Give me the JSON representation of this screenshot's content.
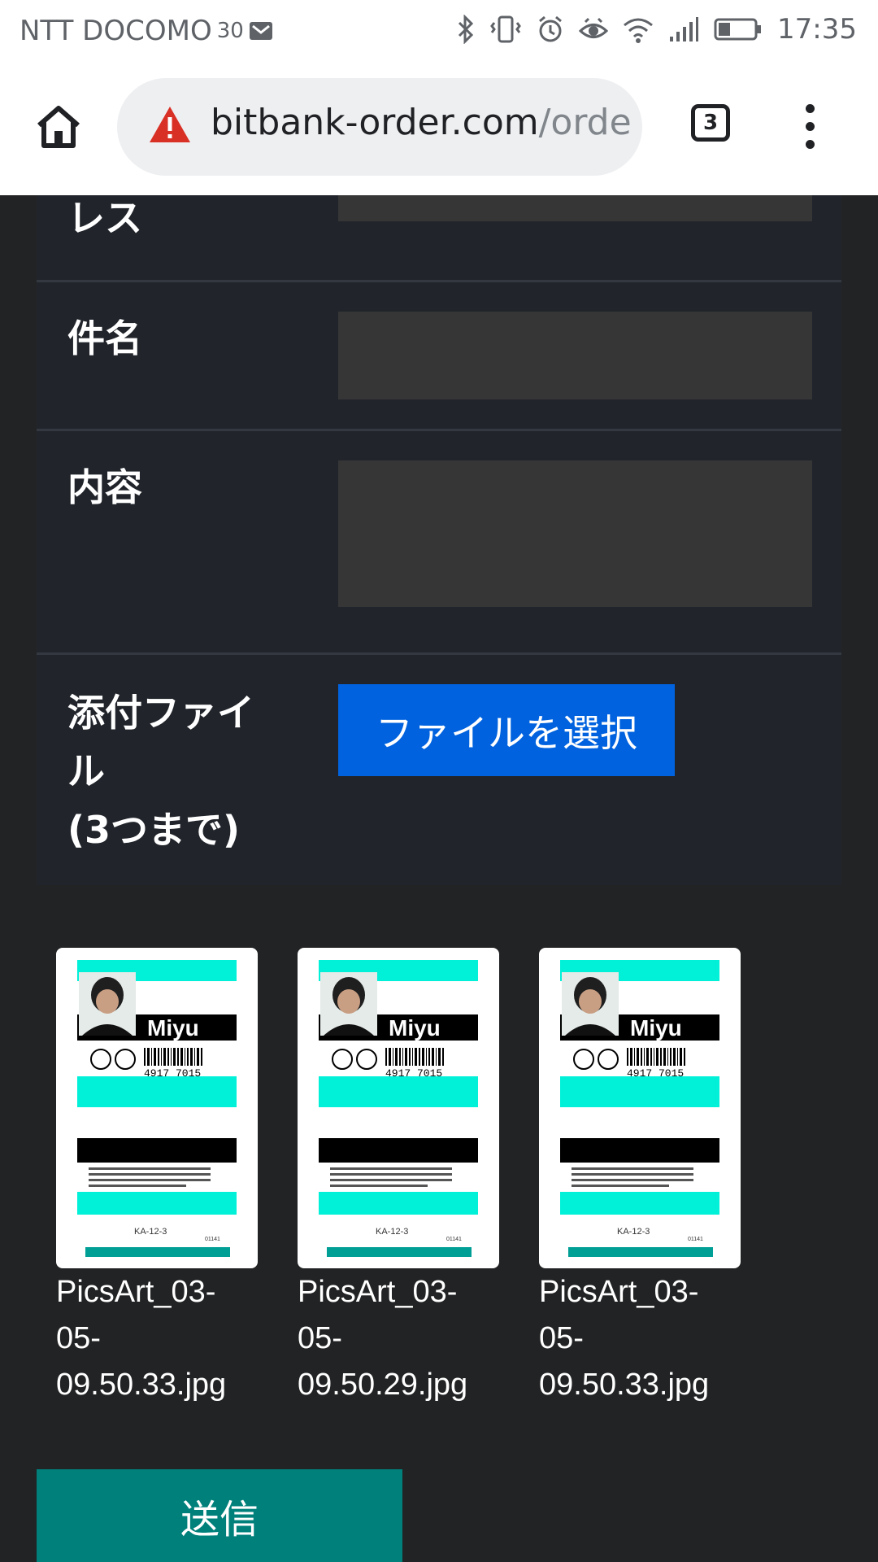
{
  "status_bar": {
    "carrier": "NTT DOCOMO",
    "carrier_extra": "30",
    "time": "17:35"
  },
  "browser": {
    "url_host": "bitbank-order.com",
    "url_path": "/orde",
    "tab_count": "3"
  },
  "form": {
    "fields": [
      {
        "label": "レス"
      },
      {
        "label": "件名"
      },
      {
        "label": "内容"
      },
      {
        "label_lines": [
          "添付ファイ",
          "ル",
          "(3つまで)"
        ]
      }
    ],
    "file_button_label": "ファイルを選択"
  },
  "attachments": [
    {
      "file_name_lines": [
        "PicsArt_03-",
        "05-",
        "09.50.33.jpg"
      ],
      "card_name": "Miyu",
      "barcode_number": "4917 7015",
      "code": "KA-12-3",
      "small_code": "01141"
    },
    {
      "file_name_lines": [
        "PicsArt_03-",
        "05-",
        "09.50.29.jpg"
      ],
      "card_name": "Miyu",
      "barcode_number": "4917 7015",
      "code": "KA-12-3",
      "small_code": "01141"
    },
    {
      "file_name_lines": [
        "PicsArt_03-",
        "05-",
        "09.50.33.jpg"
      ],
      "card_name": "Miyu",
      "barcode_number": "4917 7015",
      "code": "KA-12-3",
      "small_code": "01141"
    }
  ],
  "submit_label": "送信",
  "colors": {
    "page_bg": "#222324",
    "panel_bg": "#21252b",
    "input_bg": "#363636",
    "file_button": "#0062de",
    "submit_button": "#00807b",
    "card_cyan": "#00f0d8",
    "warning_red": "#d93025"
  }
}
